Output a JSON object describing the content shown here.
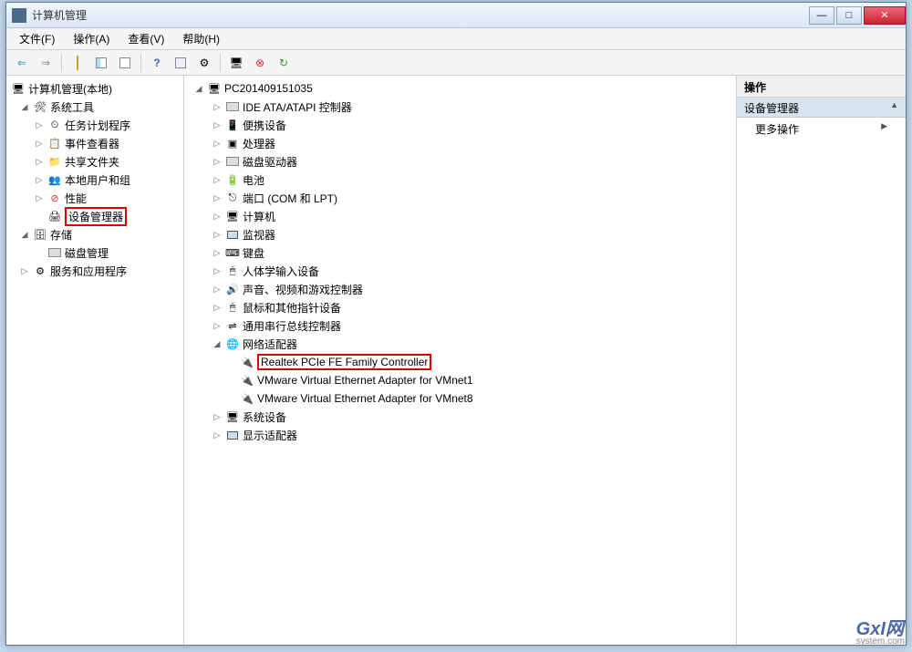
{
  "window": {
    "title": "计算机管理"
  },
  "menus": {
    "file": "文件(F)",
    "action": "操作(A)",
    "view": "查看(V)",
    "help": "帮助(H)"
  },
  "winbtns": {
    "min": "—",
    "max": "□",
    "close": "✕"
  },
  "leftTree": {
    "root": "计算机管理(本地)",
    "systools": "系统工具",
    "task": "任务计划程序",
    "event": "事件查看器",
    "share": "共享文件夹",
    "users": "本地用户和组",
    "perf": "性能",
    "devmgr": "设备管理器",
    "storage": "存储",
    "diskmgr": "磁盘管理",
    "services": "服务和应用程序"
  },
  "deviceTree": {
    "root": "PC201409151035",
    "ide": "IDE ATA/ATAPI 控制器",
    "portable": "便携设备",
    "cpu": "处理器",
    "diskdrive": "磁盘驱动器",
    "battery": "电池",
    "ports": "端口 (COM 和 LPT)",
    "computer": "计算机",
    "monitors": "监视器",
    "keyboard": "键盘",
    "hid": "人体学输入设备",
    "sound": "声音、视频和游戏控制器",
    "mouse": "鼠标和其他指针设备",
    "usb": "通用串行总线控制器",
    "network": "网络适配器",
    "nic1": "Realtek PCIe FE Family Controller",
    "nic2": "VMware Virtual Ethernet Adapter for VMnet1",
    "nic3": "VMware Virtual Ethernet Adapter for VMnet8",
    "sysdev": "系统设备",
    "display": "显示适配器"
  },
  "rightPane": {
    "header": "操作",
    "section": "设备管理器",
    "more": "更多操作",
    "arrowUp": "▲",
    "arrowRight": "▶"
  },
  "watermark": {
    "main": "GxI网",
    "sub": "system.com"
  },
  "glyphs": {
    "expOpen": "◢",
    "expClosed": "▷",
    "back": "⇐",
    "fwd": "⇒"
  }
}
